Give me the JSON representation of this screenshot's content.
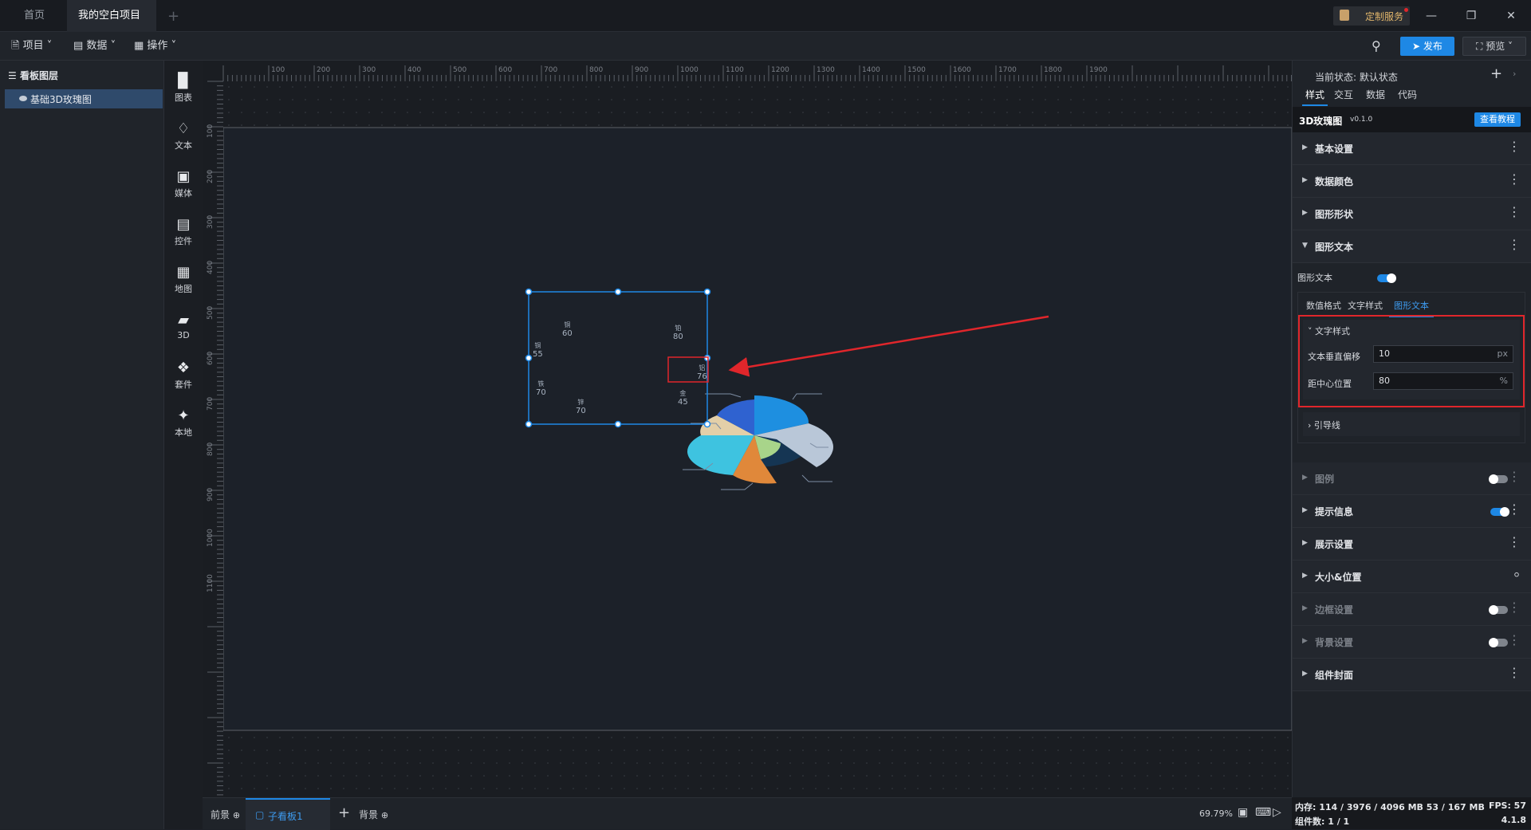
{
  "tabs": {
    "home": "首页",
    "project": "我的空白项目"
  },
  "topbar": {
    "custom_service": "定制服务"
  },
  "menubar": {
    "project": "项目",
    "data": "数据",
    "operation": "操作",
    "publish": "发布",
    "preview": "预览"
  },
  "layers": {
    "title": "看板图层",
    "item": "基础3D玫瑰图"
  },
  "toolbar": {
    "chart": "图表",
    "text": "文本",
    "media": "媒体",
    "control": "控件",
    "map": "地图",
    "3d": "3D",
    "kit": "套件",
    "local": "本地"
  },
  "ruler": {
    "top": [
      "100",
      "200",
      "300",
      "400",
      "500",
      "600",
      "700",
      "800",
      "900",
      "1000",
      "1100",
      "1200",
      "1300",
      "1400",
      "1500",
      "1600",
      "1700",
      "1800",
      "1900"
    ],
    "left": [
      "100",
      "200",
      "300",
      "400",
      "500",
      "600",
      "700",
      "800",
      "900",
      "1000",
      "1100"
    ]
  },
  "chart": {
    "labels": [
      {
        "name": "铜",
        "value": "60"
      },
      {
        "name": "铂",
        "value": "80"
      },
      {
        "name": "铜",
        "value": "55"
      },
      {
        "name": "铝",
        "value": "76"
      },
      {
        "name": "铁",
        "value": "70"
      },
      {
        "name": "锌",
        "value": "70"
      },
      {
        "name": "金",
        "value": "45"
      }
    ]
  },
  "right": {
    "state_label": "当前状态:",
    "state_value": "默认状态",
    "tabs": [
      "样式",
      "交互",
      "数据",
      "代码"
    ],
    "component": "3D玫瑰图",
    "version": "v0.1.0",
    "tutorial": "查看教程",
    "sections": {
      "basic": "基本设置",
      "data_color": "数据颜色",
      "shape": "图形形状",
      "shape_text": "图形文本",
      "legend": "图例",
      "tooltip": "提示信息",
      "display": "展示设置",
      "size_pos": "大小&位置",
      "border": "边框设置",
      "bg": "背景设置",
      "cover": "组件封面"
    },
    "shape_text_toggle": "图形文本",
    "subtabs": [
      "数值格式",
      "文字样式",
      "图形文本"
    ],
    "text_style": "文字样式",
    "vertical_offset_label": "文本垂直偏移",
    "vertical_offset_value": "10",
    "vertical_offset_unit": "px",
    "center_pos_label": "距中心位置",
    "center_pos_value": "80",
    "center_pos_unit": "%",
    "guide_line": "引导线"
  },
  "bottom": {
    "front": "前景",
    "sub_board": "子看板1",
    "background": "背景",
    "zoom": "69.79%"
  },
  "status": {
    "memory": "内存: 114 / 3976 / 4096 MB  53 / 167 MB",
    "fps": "FPS: 57",
    "components": "组件数: 1 / 1",
    "version": "4.1.8"
  },
  "colors": {
    "accent": "#1e88e5",
    "annotation": "#e0262b"
  }
}
